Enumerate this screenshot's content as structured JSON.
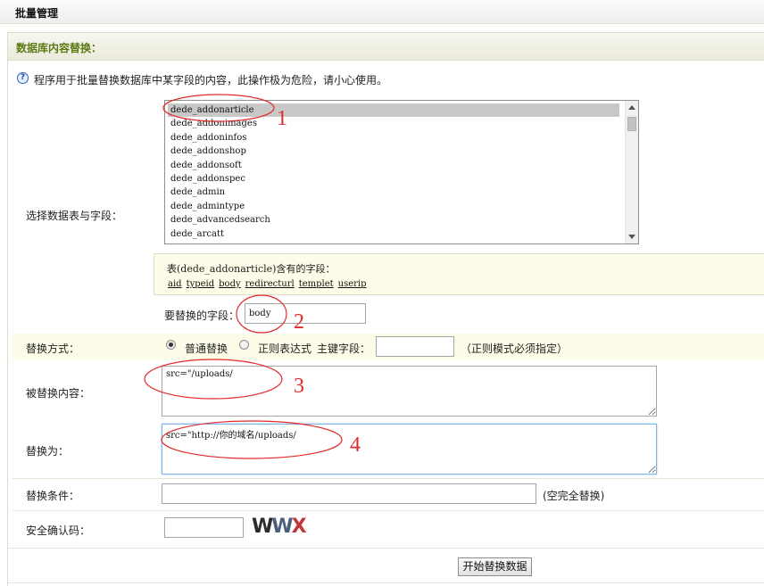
{
  "header": {
    "title": "批量管理"
  },
  "panel": {
    "title": "数据库内容替换："
  },
  "notice": {
    "text": "程序用于批量替换数据库中某字段的内容，此操作极为危险，请小心使用。"
  },
  "table_select": {
    "label": "选择数据表与字段：",
    "options": [
      "dede_addonarticle",
      "dede_addonimages",
      "dede_addoninfos",
      "dede_addonshop",
      "dede_addonsoft",
      "dede_addonspec",
      "dede_admin",
      "dede_admintype",
      "dede_advancedsearch",
      "dede_arcatt"
    ],
    "selected": "dede_addonarticle"
  },
  "fields": {
    "caption": "表(dede_addonarticle)含有的字段：",
    "items": [
      "aid",
      "typeid",
      "body",
      "redirecturl",
      "templet",
      "userip"
    ]
  },
  "replace_field": {
    "label": "要替换的字段：",
    "value": "body"
  },
  "mode": {
    "label": "替换方式：",
    "option_normal": "普通替换",
    "option_regex": "正则表达式",
    "selected": "普通替换",
    "key_field_label": "主键字段：",
    "key_field_value": "",
    "hint": "（正则模式必须指定）"
  },
  "replaced_content": {
    "label": "被替换内容：",
    "value": "src=\"/uploads/"
  },
  "replace_with": {
    "label": "替换为：",
    "value": "src=\"http://你的域名/uploads/"
  },
  "condition": {
    "label": "替换条件：",
    "value": "",
    "hint": "(空完全替换)"
  },
  "captcha": {
    "label": "安全确认码：",
    "value": "",
    "image_text": "WWX"
  },
  "submit": {
    "label": "开始替换数据"
  },
  "annotations": [
    "1",
    "2",
    "3",
    "4"
  ],
  "colors": {
    "accent_green": "#5c7a12",
    "annotation_red": "#e22a2a",
    "highlight_row": "#fcfce8"
  }
}
